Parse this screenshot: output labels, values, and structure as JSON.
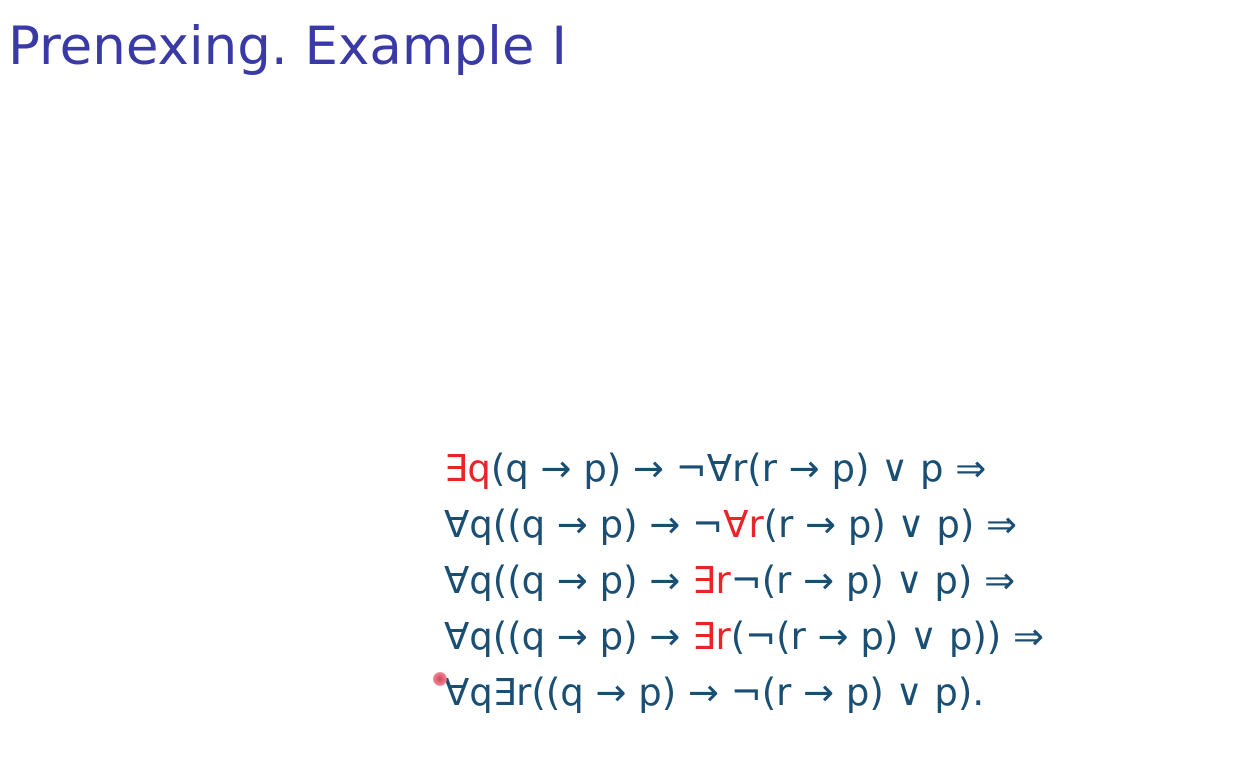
{
  "slide": {
    "title": "Prenexing. Example I",
    "lines": [
      [
        {
          "text": "∃q",
          "highlight": true
        },
        {
          "text": "(q → p) → ¬∀r(r → p) ∨ p ⇒",
          "highlight": false
        }
      ],
      [
        {
          "text": "∀q((q → p) → ¬",
          "highlight": false
        },
        {
          "text": "∀r",
          "highlight": true
        },
        {
          "text": "(r → p) ∨ p) ⇒",
          "highlight": false
        }
      ],
      [
        {
          "text": "∀q((q → p) → ",
          "highlight": false
        },
        {
          "text": "∃r",
          "highlight": true
        },
        {
          "text": "¬(r → p) ∨ p) ⇒",
          "highlight": false
        }
      ],
      [
        {
          "text": "∀q((q → p) → ",
          "highlight": false
        },
        {
          "text": "∃r",
          "highlight": true
        },
        {
          "text": "(¬(r → p) ∨ p)) ⇒",
          "highlight": false
        }
      ],
      [
        {
          "text": "∀q∃r((q → p) → ¬(r → p) ∨ p).",
          "highlight": false
        }
      ]
    ]
  },
  "colors": {
    "title": "#3a3aa6",
    "formula": "#1a4f73",
    "highlight": "#e8262a",
    "background": "#ffffff"
  }
}
